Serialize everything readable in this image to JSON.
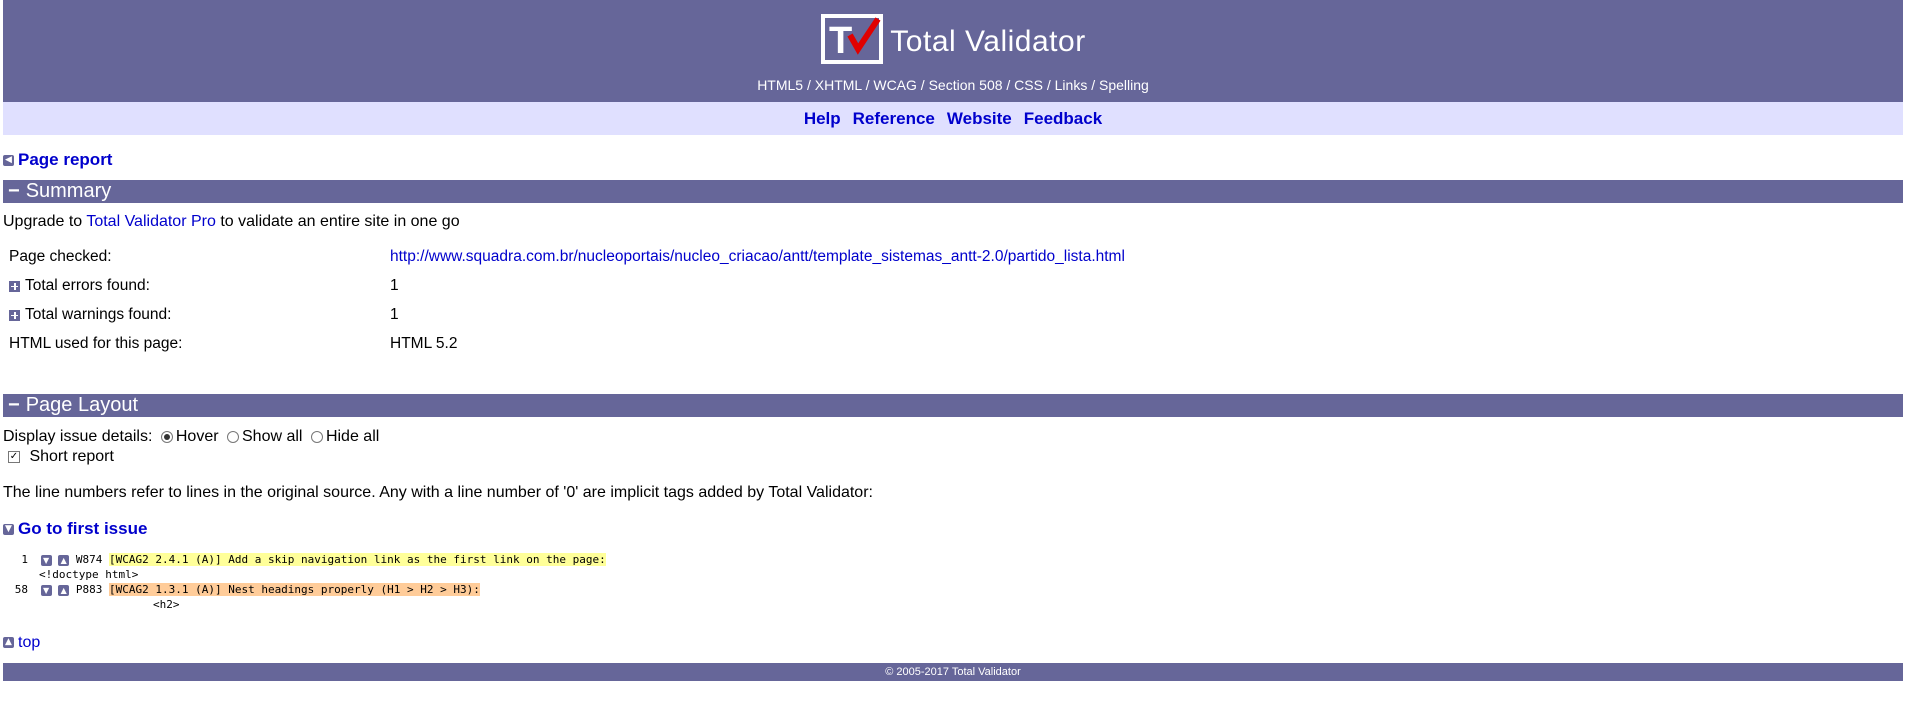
{
  "header": {
    "title": "Total Validator",
    "logo_letters": "TV",
    "tagline": "HTML5 / XHTML / WCAG / Section 508 / CSS / Links / Spelling"
  },
  "nav": {
    "items": [
      "Help",
      "Reference",
      "Website",
      "Feedback"
    ]
  },
  "back_link": "Page report",
  "summary": {
    "heading": "Summary",
    "upgrade_prefix": "Upgrade to ",
    "upgrade_link": "Total Validator Pro",
    "upgrade_suffix": " to validate an entire site in one go",
    "rows": [
      {
        "label": "Page checked:",
        "value": "http://www.squadra.com.br/nucleoportais/nucleo_criacao/antt/template_sistemas_antt-2.0/partido_lista.html"
      },
      {
        "label": "Total errors found:",
        "value": "1"
      },
      {
        "label": "Total warnings found:",
        "value": "1"
      },
      {
        "label": "HTML used for this page:",
        "value": "HTML 5.2"
      }
    ]
  },
  "layout": {
    "heading": "Page Layout",
    "display_label": "Display issue details:",
    "options": [
      "Hover",
      "Show all",
      "Hide all"
    ],
    "selected_option": "Hover",
    "short_report_label": "Short report",
    "short_report_checked": true,
    "note": "The line numbers refer to lines in the original source. Any with a line number of '0' are implicit tags added by Total Validator:",
    "first_issue_link": "Go to first issue",
    "issues": [
      {
        "line": "1",
        "code": "W874",
        "message": "[WCAG2 2.4.1 (A)] Add a skip navigation link as the first link on the page:",
        "source": "<!doctype html>"
      },
      {
        "line": "58",
        "code": "P883",
        "message": "[WCAG2 1.3.1 (A)] Nest headings properly (H1 > H2 > H3):",
        "source": "<h2>"
      }
    ],
    "top_link": "top"
  },
  "footer": {
    "text": "© 2005-2017 Total Validator"
  },
  "colors": {
    "brand": "#666699",
    "nav_bg": "#e0e0ff",
    "link": "#0000cc",
    "warning_highlight": "#ffff99",
    "error_highlight": "#ffcc99"
  }
}
